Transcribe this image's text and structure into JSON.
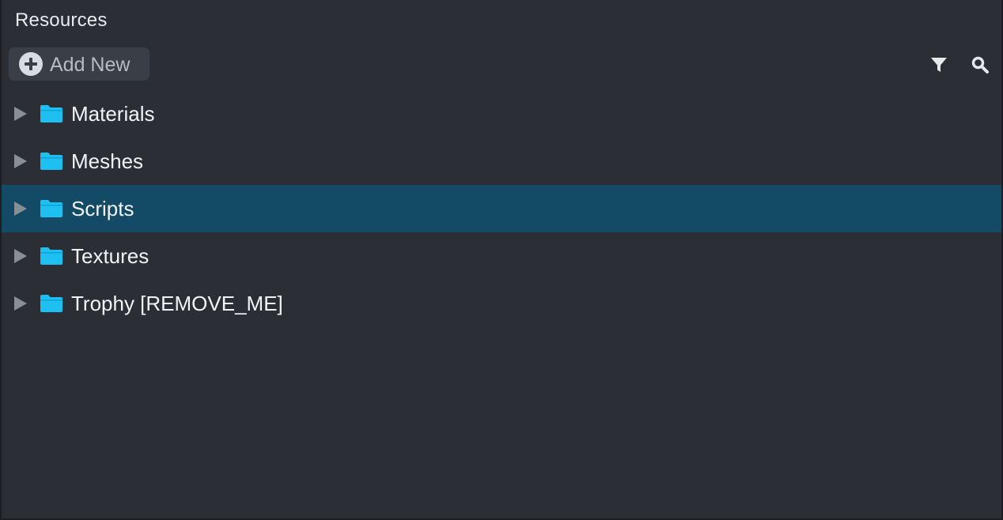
{
  "panel": {
    "title": "Resources"
  },
  "toolbar": {
    "add_label": "Add New",
    "add_icon": "plus-circle-icon",
    "filter_icon": "filter-icon",
    "search_icon": "search-icon"
  },
  "tree": {
    "items": [
      {
        "label": "Materials",
        "icon": "folder-icon",
        "selected": false
      },
      {
        "label": "Meshes",
        "icon": "folder-icon",
        "selected": false
      },
      {
        "label": "Scripts",
        "icon": "folder-icon",
        "selected": true
      },
      {
        "label": "Textures",
        "icon": "folder-icon",
        "selected": false
      },
      {
        "label": "Trophy [REMOVE_ME]",
        "icon": "folder-icon",
        "selected": false
      }
    ]
  },
  "colors": {
    "background": "#2b2e35",
    "selection": "#134a65",
    "folder": "#1ec0f2",
    "text": "#f2f3f5"
  }
}
